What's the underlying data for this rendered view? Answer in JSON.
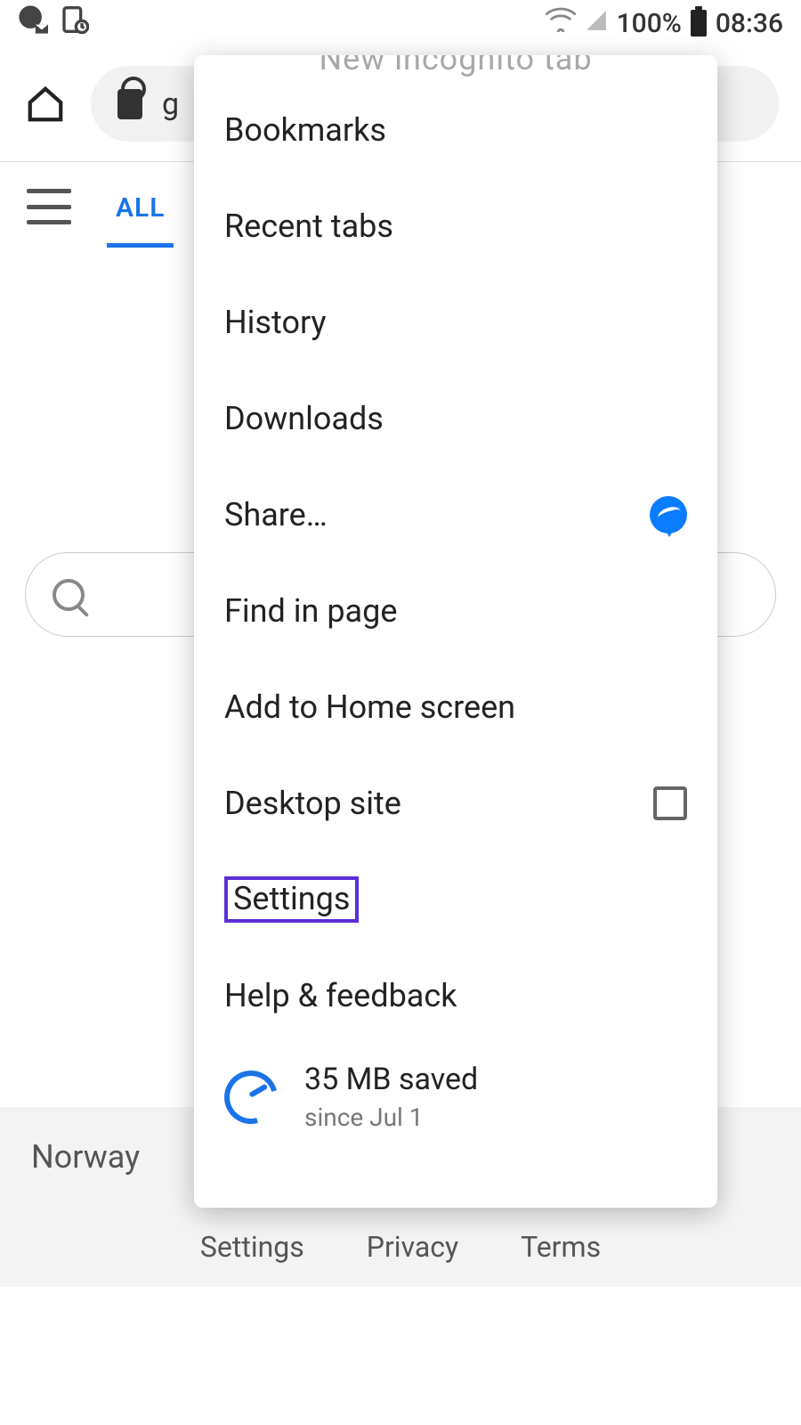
{
  "status": {
    "battery_pct": "100%",
    "time": "08:36"
  },
  "browser": {
    "url_fragment": "g"
  },
  "tabs": {
    "all": "ALL"
  },
  "location": "Norway",
  "footer": {
    "settings": "Settings",
    "privacy": "Privacy",
    "terms": "Terms"
  },
  "menu": {
    "incognito": "New incognito tab",
    "bookmarks": "Bookmarks",
    "recent": "Recent tabs",
    "history": "History",
    "downloads": "Downloads",
    "share": "Share…",
    "find": "Find in page",
    "add_home": "Add to Home screen",
    "desktop": "Desktop site",
    "settings": "Settings",
    "help": "Help & feedback",
    "data_saver_title": "35 MB saved",
    "data_saver_sub": "since Jul 1"
  }
}
